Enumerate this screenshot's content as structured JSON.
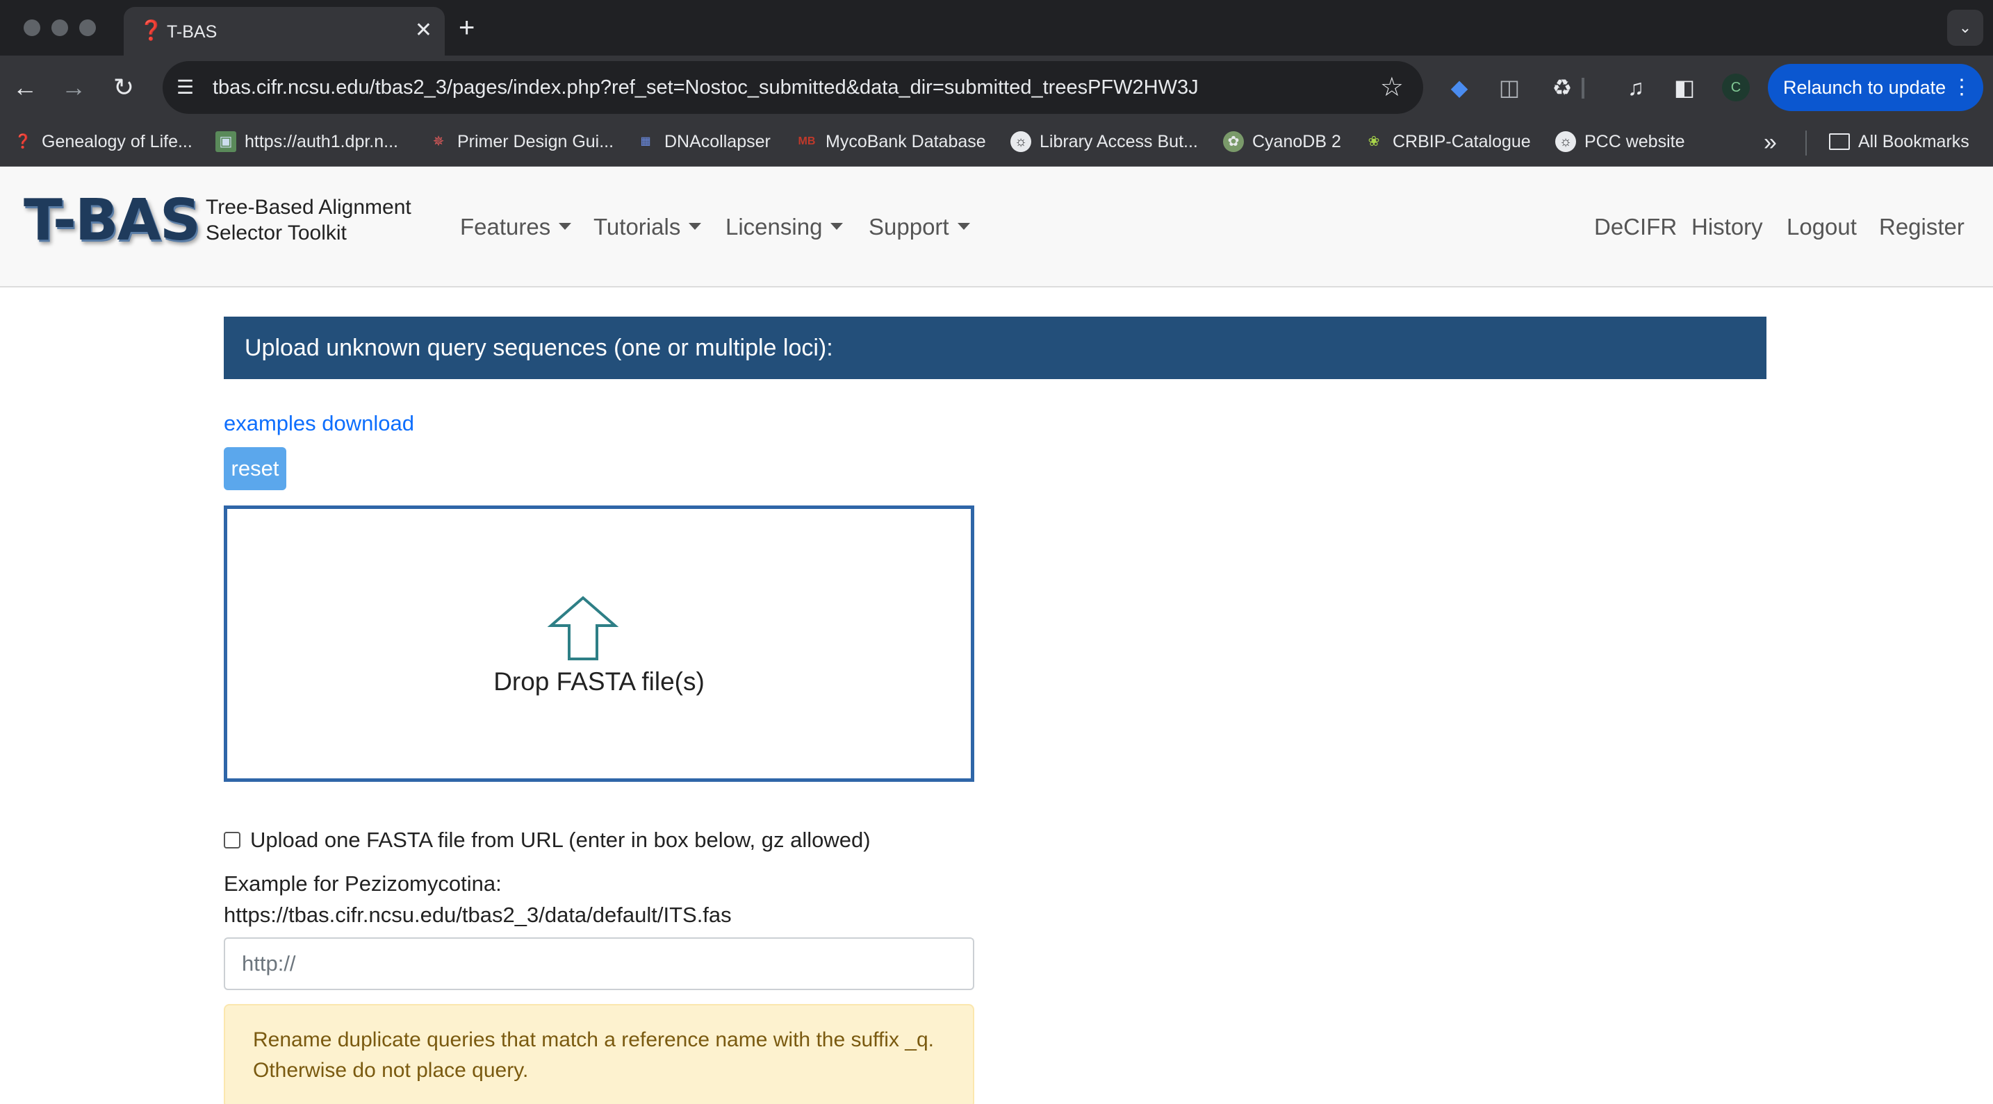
{
  "browser": {
    "tab_title": "T-BAS",
    "url": "tbas.cifr.ncsu.edu/tbas2_3/pages/index.php?ref_set=Nostoc_submitted&data_dir=submitted_treesPFW2HW3J",
    "relaunch_label": "Relaunch to update",
    "profile_initial": "C",
    "bookmarks": [
      {
        "label": "Genealogy of Life...",
        "icon": "tbas-favicon"
      },
      {
        "label": "https://auth1.dpr.n...",
        "icon": "image-icon"
      },
      {
        "label": "Primer Design Gui...",
        "icon": "dna-icon"
      },
      {
        "label": "DNAcollapser",
        "icon": "box-icon"
      },
      {
        "label": "MycoBank Database",
        "icon": "mb-icon"
      },
      {
        "label": "Library Access But...",
        "icon": "globe-icon"
      },
      {
        "label": "CyanoDB 2",
        "icon": "cyanodb-icon"
      },
      {
        "label": "CRBIP-Catalogue",
        "icon": "leaf-icon"
      },
      {
        "label": "PCC website",
        "icon": "globe-icon"
      }
    ],
    "all_bookmarks_label": "All Bookmarks"
  },
  "site": {
    "logo_text": "T-BAS",
    "logo_sub_line1": "Tree-Based Alignment",
    "logo_sub_line2": "Selector Toolkit",
    "menu": [
      "Features",
      "Tutorials",
      "Licensing",
      "Support"
    ],
    "menu_right": [
      "DeCIFR",
      "History",
      "Logout",
      "Register"
    ]
  },
  "main": {
    "header": "Upload unknown query sequences (one or multiple loci):",
    "examples_link": "examples download",
    "reset_label": "reset",
    "drop_text": "Drop FASTA file(s)",
    "url_checkbox_label": "Upload one FASTA file from URL (enter in box below, gz allowed)",
    "example_label": "Example for Pezizomycotina:",
    "example_url": "https://tbas.cifr.ncsu.edu/tbas2_3/data/default/ITS.fas",
    "url_placeholder": "http://",
    "alert_text": "Rename duplicate queries that match a reference name with the suffix _q. Otherwise do not place query."
  },
  "colors": {
    "header_bar": "#234f7a",
    "link": "#0d6efd",
    "reset_button": "#5ba7ec",
    "dropzone_border": "#2f66a8",
    "alert_bg": "#fdf2cf",
    "relaunch_button": "#0b57d0"
  }
}
